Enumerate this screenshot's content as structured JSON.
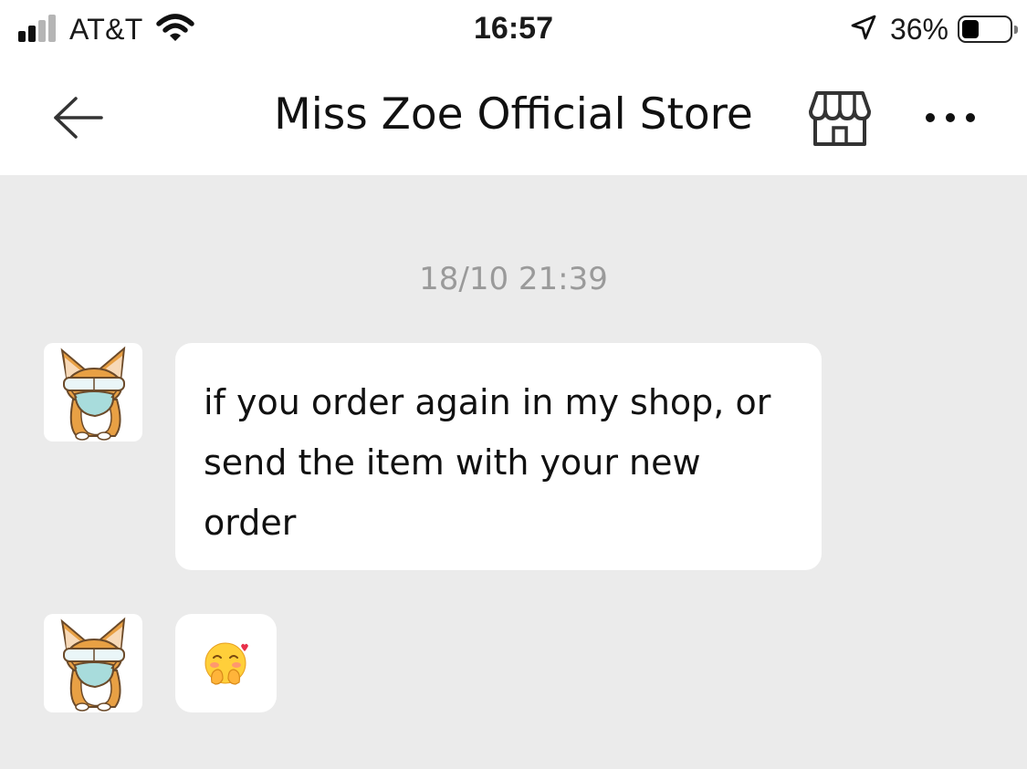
{
  "status_bar": {
    "carrier": "AT&T",
    "time": "16:57",
    "battery_percent": "36%",
    "battery_level": 0.36,
    "signal_bars_active": 2,
    "signal_bars_total": 4
  },
  "header": {
    "title": "Miss Zoe Official Store",
    "back_icon": "arrow-left-icon",
    "store_icon": "storefront-icon",
    "more_icon": "more-horizontal-icon"
  },
  "chat": {
    "timestamp": "18/10 21:39",
    "messages": [
      {
        "sender_avatar": "corgi-avatar",
        "lines": [
          "if you order again in my shop, or",
          "send the item with your new",
          "order"
        ]
      },
      {
        "sender_avatar": "corgi-avatar",
        "emoji": "blushing-hands-emoji"
      }
    ]
  },
  "colors": {
    "chat_background": "#ebebeb",
    "bubble": "#ffffff",
    "timestamp": "#9a9a9a",
    "corgi_orange": "#e8a044"
  }
}
